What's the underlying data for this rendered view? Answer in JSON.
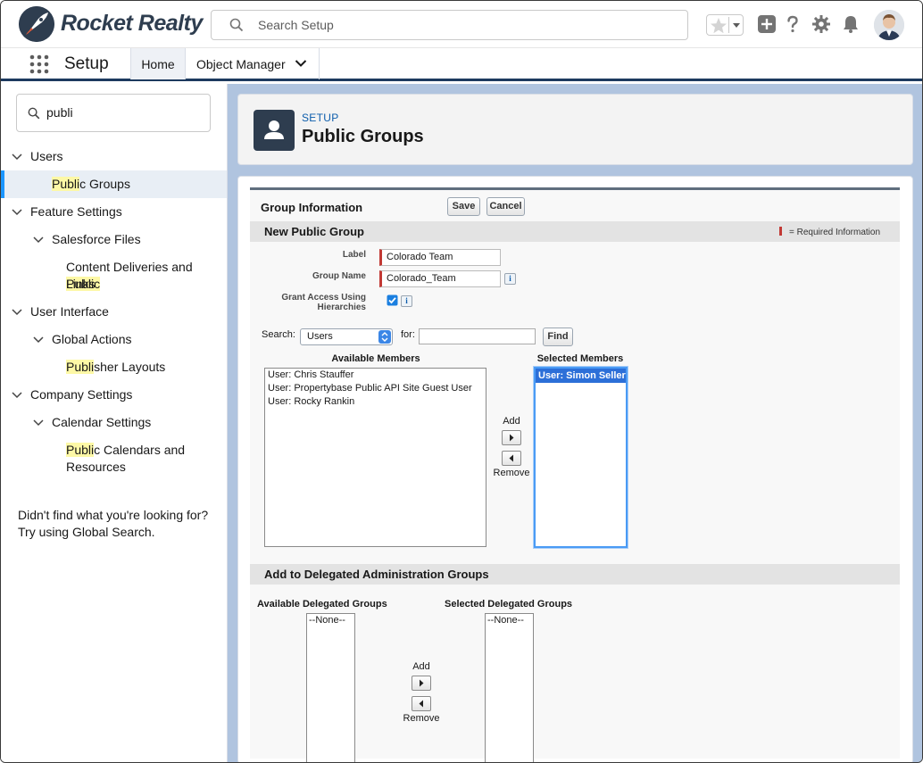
{
  "header": {
    "app_brand": "Rocket Realty",
    "search_placeholder": "Search Setup"
  },
  "context_bar": {
    "app_name": "Setup",
    "tabs": [
      {
        "label": "Home"
      },
      {
        "label": "Object Manager"
      }
    ]
  },
  "sidebar": {
    "quick_find_value": "publi",
    "tree": [
      {
        "label": "Users",
        "level": 0
      },
      {
        "pre": "",
        "hl": "Publi",
        "post": "c Groups",
        "level": 1,
        "selected": true
      },
      {
        "label": "Feature Settings",
        "level": 0
      },
      {
        "label": "Salesforce Files",
        "level": 1
      },
      {
        "pre": "Content Deliveries and ",
        "hl": "Public",
        "post": "",
        "line2": "Links",
        "level": 2
      },
      {
        "label": "User Interface",
        "level": 0
      },
      {
        "label": "Global Actions",
        "level": 1
      },
      {
        "pre": "",
        "hl": "Publi",
        "post": "sher Layouts",
        "level": 2
      },
      {
        "label": "Company Settings",
        "level": 0
      },
      {
        "label": "Calendar Settings",
        "level": 1
      },
      {
        "pre": "",
        "hl": "Publi",
        "post": "c Calendars and",
        "line2": "Resources",
        "level": 2
      }
    ],
    "footer_line1": "Didn't find what you're looking for?",
    "footer_line2": "Try using Global Search."
  },
  "page_header": {
    "eyebrow": "SETUP",
    "title": "Public Groups"
  },
  "form": {
    "title": "Group Information",
    "save_label": "Save",
    "cancel_label": "Cancel",
    "section1_title": "New Public Group",
    "required_legend": "= Required Information",
    "label_field_label": "Label",
    "label_field_value": "Colorado Team",
    "group_name_label": "Group Name",
    "group_name_value": "Colorado_Team",
    "grant_access_line1": "Grant Access Using",
    "grant_access_line2": "Hierarchies",
    "grant_access_checked": true,
    "search_label": "Search:",
    "search_select_value": "Users",
    "for_label": "for:",
    "find_label": "Find",
    "available_members_heading": "Available Members",
    "available_members": [
      "User: Chris Stauffer",
      "User: Propertybase Public API Site Guest User",
      "User: Rocky Rankin"
    ],
    "selected_members_heading": "Selected Members",
    "selected_members": [
      "User: Simon Seller"
    ],
    "add_label": "Add",
    "remove_label": "Remove",
    "section2_title": "Add to Delegated Administration Groups",
    "available_delegated_heading": "Available Delegated Groups",
    "available_delegated": [
      "--None--"
    ],
    "selected_delegated_heading": "Selected Delegated Groups",
    "selected_delegated": [
      "--None--"
    ],
    "add2_label": "Add",
    "remove2_label": "Remove"
  },
  "colors": {
    "brand_dark": "#2e3d4f",
    "accent_blue": "#1b96ff",
    "required_red": "#c23934",
    "page_bg": "#b0c4df"
  }
}
